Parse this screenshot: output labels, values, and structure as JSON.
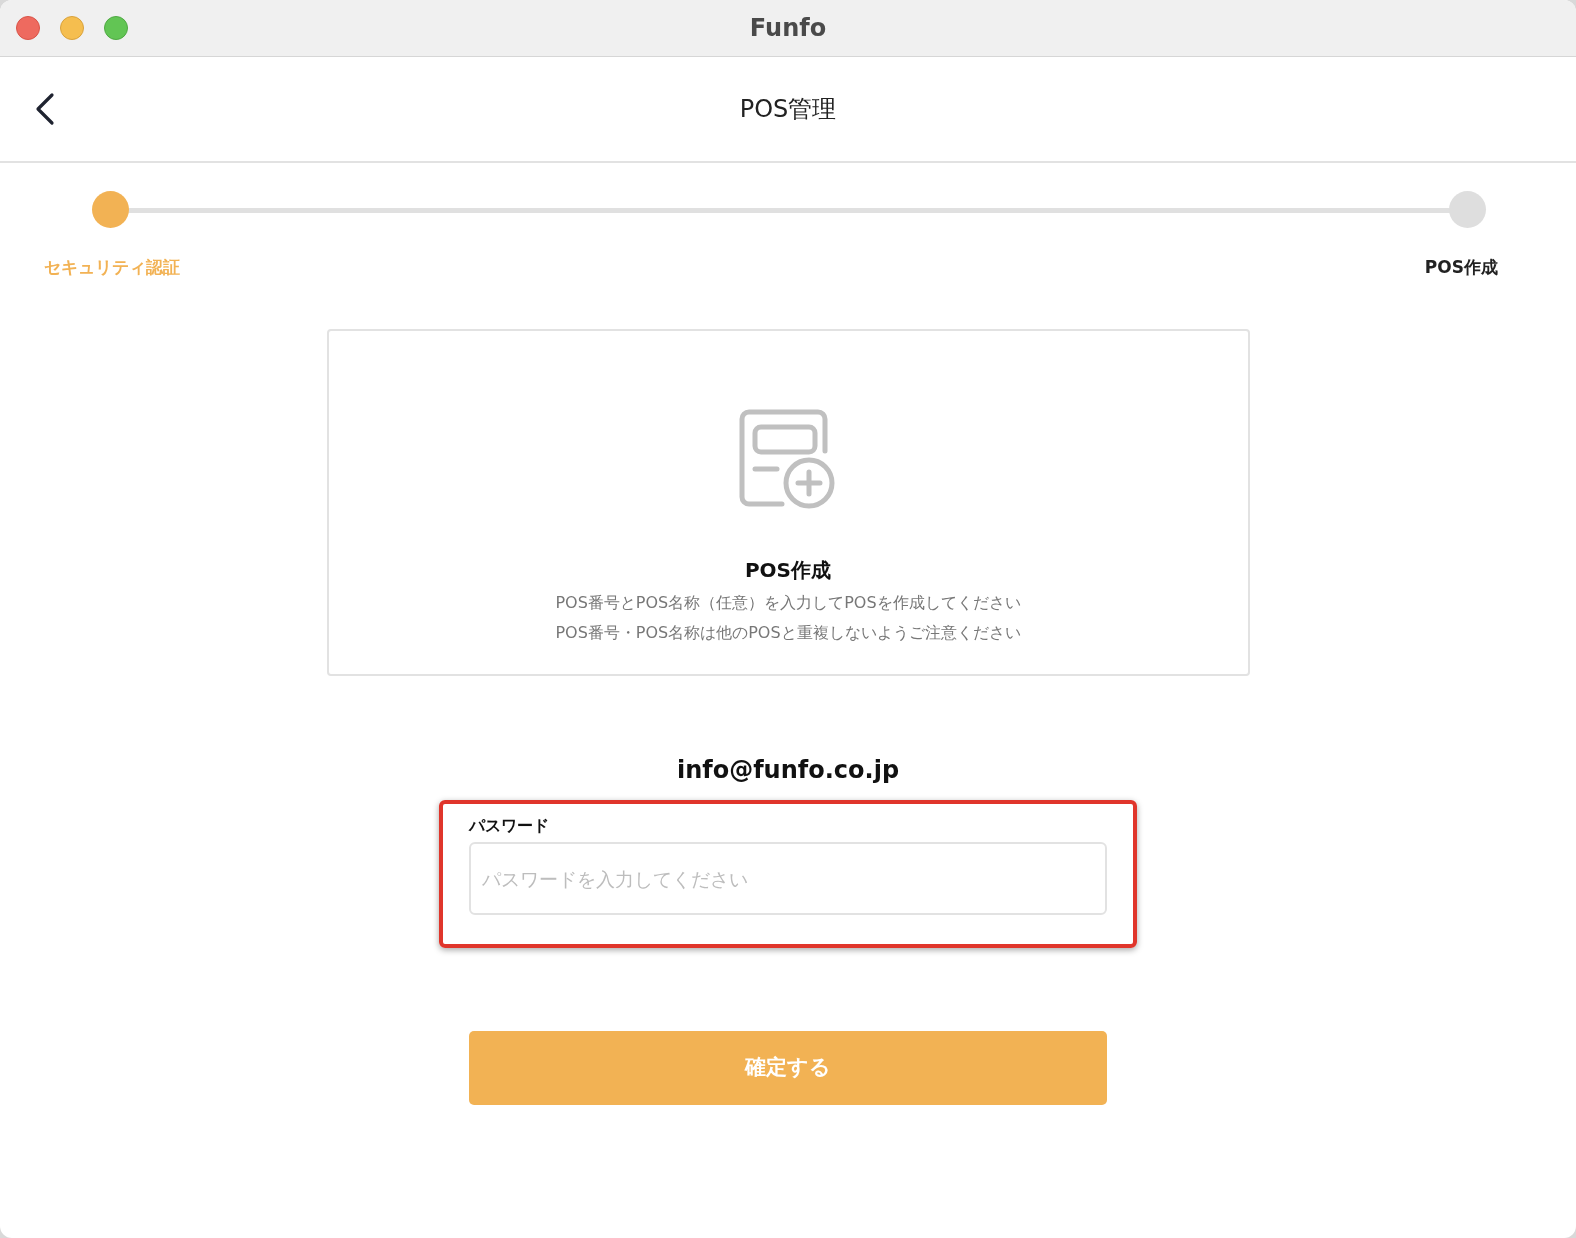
{
  "window": {
    "title": "Funfo"
  },
  "header": {
    "title": "POS管理"
  },
  "steps": [
    {
      "label": "セキュリティ認証",
      "active": true
    },
    {
      "label": "POS作成",
      "active": false
    }
  ],
  "card": {
    "title": "POS作成",
    "lines": [
      "POS番号とPOS名称（任意）を入力してPOSを作成してください",
      "POS番号・POS名称は他のPOSと重複しないようご注意ください"
    ]
  },
  "email": "info@funfo.co.jp",
  "password": {
    "label": "パスワード",
    "placeholder": "パスワードを入力してください",
    "highlighted": true
  },
  "confirm_button": "確定する"
}
